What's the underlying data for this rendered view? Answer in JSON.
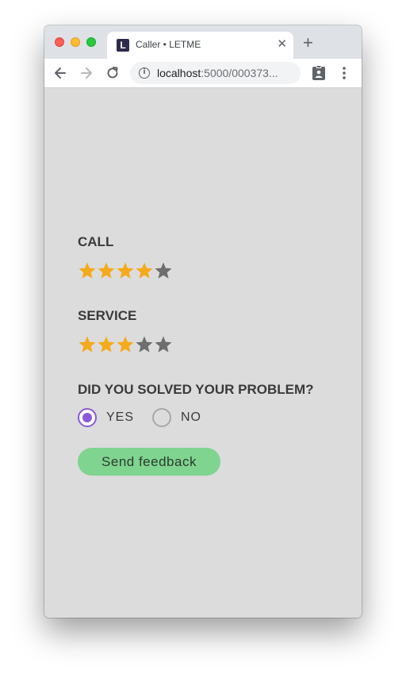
{
  "browser": {
    "tab_title": "Caller • LETME",
    "favicon_letter": "L",
    "tab_close": "✕",
    "new_tab": "+",
    "url_host": "localhost",
    "url_path": ":5000/000373...",
    "info_icon": "i"
  },
  "form": {
    "call_label": "CALL",
    "call_rating": 4,
    "service_label": "SERVICE",
    "service_rating": 3,
    "max_rating": 5,
    "problem_label": "DID YOU SOLVED YOUR PROBLEM?",
    "options": [
      {
        "label": "YES",
        "selected": true
      },
      {
        "label": "NO",
        "selected": false
      }
    ],
    "submit_label": "Send feedback"
  },
  "colors": {
    "star_filled": "#f5aa1b",
    "star_empty": "#6e6e6e",
    "radio_accent": "#8a5ad6",
    "button_bg": "#7fd48f",
    "content_bg": "#dcdcdd"
  }
}
